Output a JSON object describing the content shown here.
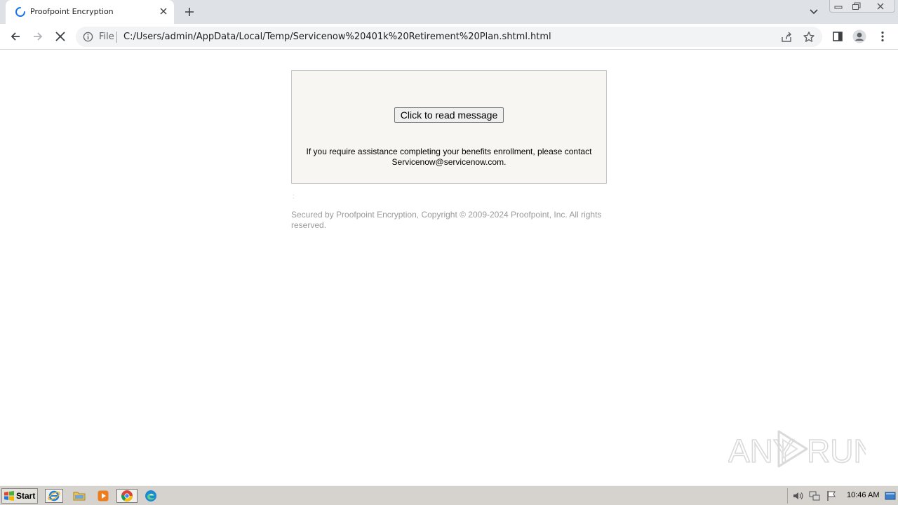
{
  "browser": {
    "tab_title": "Proofpoint Encryption",
    "address_scheme_label": "File",
    "url": "C:/Users/admin/AppData/Local/Temp/Servicenow%20401k%20Retirement%20Plan.shtml.html"
  },
  "page": {
    "read_button_label": "Click to read message",
    "assistance_line1": "If you require assistance completing your benefits enrollment, please contact",
    "assistance_line2": "Servicenow@servicenow.com.",
    "stray_mark": ":",
    "footer_line1": "Secured by Proofpoint Encryption, Copyright © 2009-2024 Proofpoint, Inc. All rights",
    "footer_line2": "reserved."
  },
  "watermark": {
    "text_left": "ANY",
    "text_right": "RUN"
  },
  "taskbar": {
    "start_label": "Start",
    "clock": "10:46 AM",
    "apps": [
      "internet-explorer-icon",
      "file-explorer-icon",
      "media-player-icon",
      "chrome-icon",
      "edge-icon"
    ]
  },
  "colors": {
    "chrome_tabbar": "#dee1e6",
    "message_box_bg": "#f8f6f3",
    "footer_text": "#9a9a9a",
    "taskbar": "#d6d3ce"
  }
}
